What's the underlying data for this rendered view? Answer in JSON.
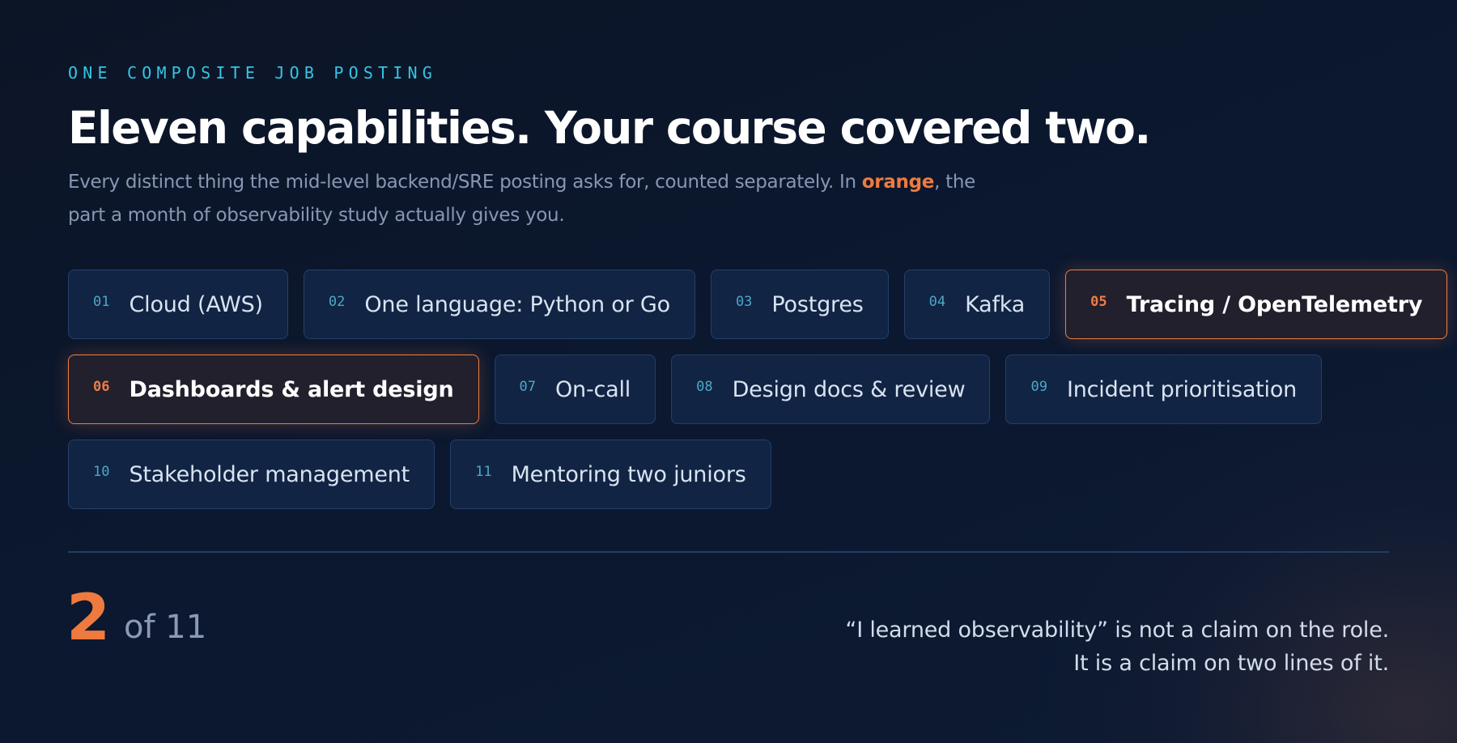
{
  "eyebrow": "ONE COMPOSITE JOB POSTING",
  "headline": "Eleven capabilities. Your course covered two.",
  "subtitle": {
    "before": "Every distinct thing the mid-level backend/SRE posting asks for, counted separately. In ",
    "highlight": "orange",
    "after": ", the part a month of observability study actually gives you."
  },
  "capabilities": [
    {
      "num": "01",
      "label": "Cloud (AWS)",
      "covered": false
    },
    {
      "num": "02",
      "label": "One language: Python or Go",
      "covered": false
    },
    {
      "num": "03",
      "label": "Postgres",
      "covered": false
    },
    {
      "num": "04",
      "label": "Kafka",
      "covered": false
    },
    {
      "num": "05",
      "label": "Tracing / OpenTelemetry",
      "covered": true
    },
    {
      "num": "06",
      "label": "Dashboards & alert design",
      "covered": true
    },
    {
      "num": "07",
      "label": "On-call",
      "covered": false
    },
    {
      "num": "08",
      "label": "Design docs & review",
      "covered": false
    },
    {
      "num": "09",
      "label": "Incident prioritisation",
      "covered": false
    },
    {
      "num": "10",
      "label": "Stakeholder management",
      "covered": false
    },
    {
      "num": "11",
      "label": "Mentoring two juniors",
      "covered": false
    }
  ],
  "score": {
    "value": "2",
    "of": "of 11"
  },
  "quote": {
    "line1": "“I learned observability” is not a claim on the role.",
    "line2": "It is a claim on two lines of it."
  },
  "colors": {
    "accent": "#ee7a3f",
    "eyebrow": "#35c6e4",
    "background": "#0b1830",
    "chip": "#112443"
  }
}
